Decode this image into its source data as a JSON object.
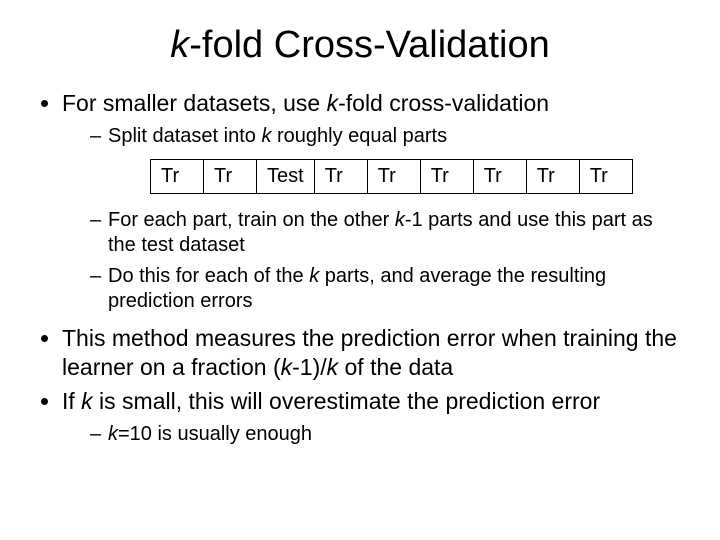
{
  "title_prefix_italic": "k",
  "title_rest": "-fold Cross-Validation",
  "bullets": {
    "b1_pre": "For smaller datasets, use ",
    "b1_ital": "k",
    "b1_post": "-fold cross-validation",
    "s1_pre": "Split dataset into ",
    "s1_ital": "k",
    "s1_post": " roughly equal parts",
    "s2_pre": "For each part, train on the other ",
    "s2_ital": "k",
    "s2_post": "-1 parts and use this part as the test dataset",
    "s3_pre": "Do this for each of the ",
    "s3_ital": "k",
    "s3_post": " parts, and average the resulting prediction errors",
    "b2_pre": "This method measures the prediction error when training the learner on a fraction (",
    "b2_ital1": "k",
    "b2_mid": "-1)/",
    "b2_ital2": "k",
    "b2_post": " of the data",
    "b3_pre": "If ",
    "b3_ital": "k",
    "b3_post": " is small, this will overestimate the prediction error",
    "s4_ital": "k",
    "s4_post": "=10 is usually enough"
  },
  "folds": {
    "c0": "Tr",
    "c1": "Tr",
    "c2": "Test",
    "c3": "Tr",
    "c4": "Tr",
    "c5": "Tr",
    "c6": "Tr",
    "c7": "Tr",
    "c8": "Tr"
  }
}
